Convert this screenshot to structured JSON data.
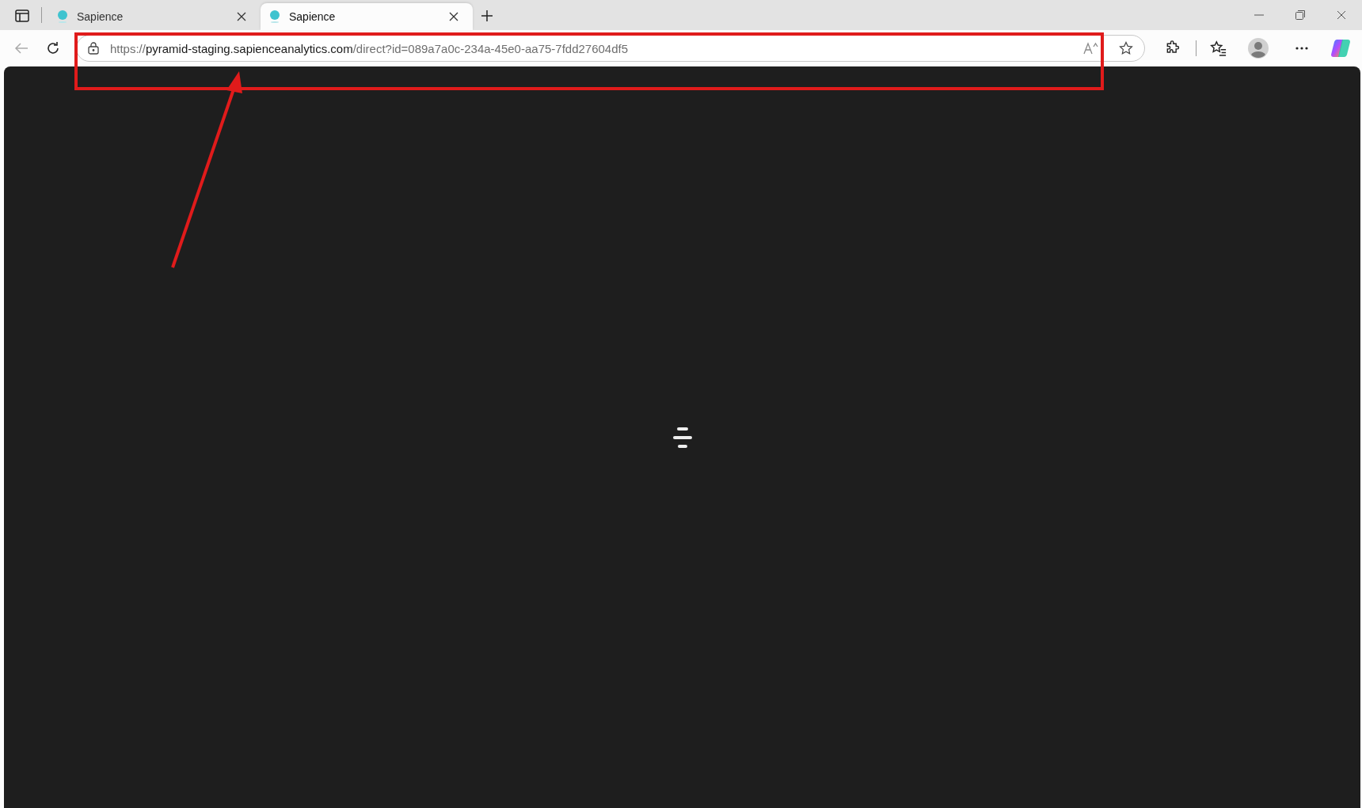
{
  "tabs": [
    {
      "title": "Sapience",
      "selected": false
    },
    {
      "title": "Sapience",
      "selected": true
    }
  ],
  "address": {
    "scheme": "https://",
    "host": "pyramid-staging.sapienceanalytics.com",
    "path": "/direct?id=089a7a0c-234a-45e0-aa75-7fdd27604df5"
  }
}
